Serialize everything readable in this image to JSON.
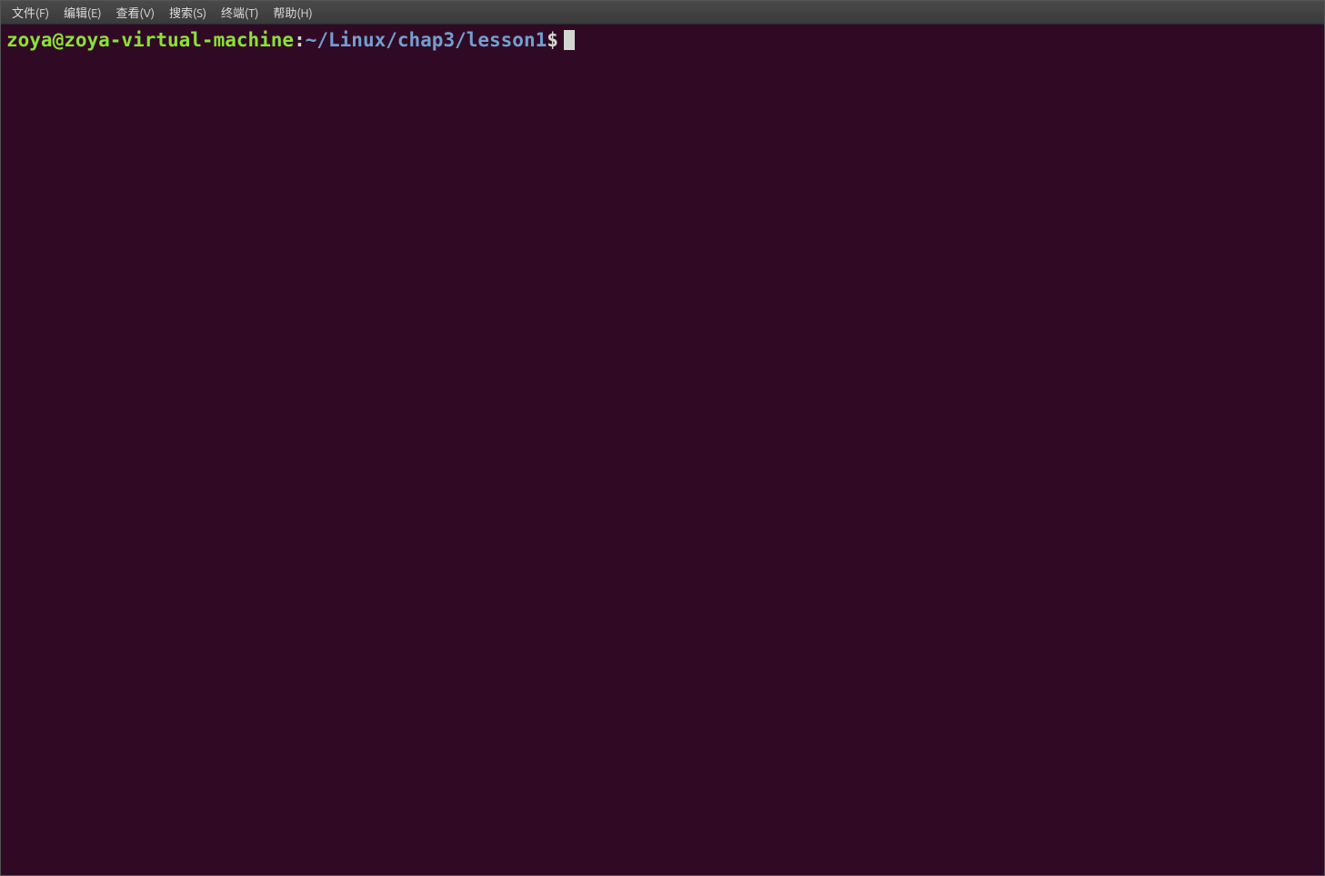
{
  "menu": {
    "items": [
      "文件(F)",
      "编辑(E)",
      "查看(V)",
      "搜索(S)",
      "终端(T)",
      "帮助(H)"
    ]
  },
  "prompt": {
    "user_host": "zoya@zoya-virtual-machine",
    "colon": ":",
    "path": "~/Linux/chap3/lesson1",
    "dollar": "$"
  }
}
